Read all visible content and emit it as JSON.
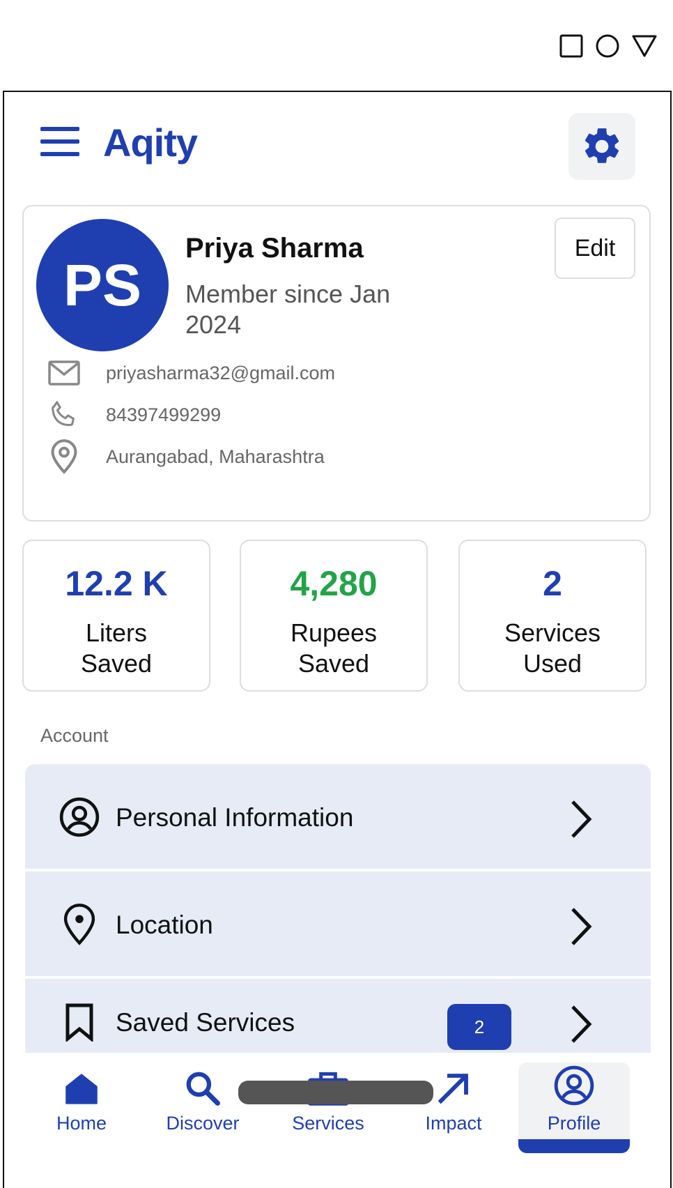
{
  "app": {
    "brand": "Aqity"
  },
  "profile": {
    "initials": "PS",
    "name": "Priya Sharma",
    "member_since": "Member since Jan 2024",
    "edit_label": "Edit",
    "email": "priyasharma32@gmail.com",
    "phone": "84397499299",
    "location": "Aurangabad, Maharashtra"
  },
  "stats": [
    {
      "value": "12.2 K",
      "label": "Liters Saved",
      "color": "#1f3fb0"
    },
    {
      "value": "4,280",
      "label": "Rupees Saved",
      "color": "#22a447"
    },
    {
      "value": "2",
      "label": "Services Used",
      "color": "#1f3fb0"
    }
  ],
  "account": {
    "section_title": "Account",
    "items": [
      {
        "label": "Personal Information",
        "icon": "user-circle-icon"
      },
      {
        "label": "Location",
        "icon": "map-pin-icon"
      },
      {
        "label": "Saved Services",
        "icon": "bookmark-icon",
        "badge": "2"
      }
    ]
  },
  "nav": {
    "items": [
      {
        "label": "Home",
        "icon": "home-icon"
      },
      {
        "label": "Discover",
        "icon": "search-icon"
      },
      {
        "label": "Services",
        "icon": "toolbox-icon"
      },
      {
        "label": "Impact",
        "icon": "arrow-up-right-icon"
      },
      {
        "label": "Profile",
        "icon": "user-circle-icon",
        "active": true
      }
    ]
  },
  "colors": {
    "primary": "#1f3fb0",
    "success": "#22a447",
    "list_bg": "#e6ebf6"
  }
}
